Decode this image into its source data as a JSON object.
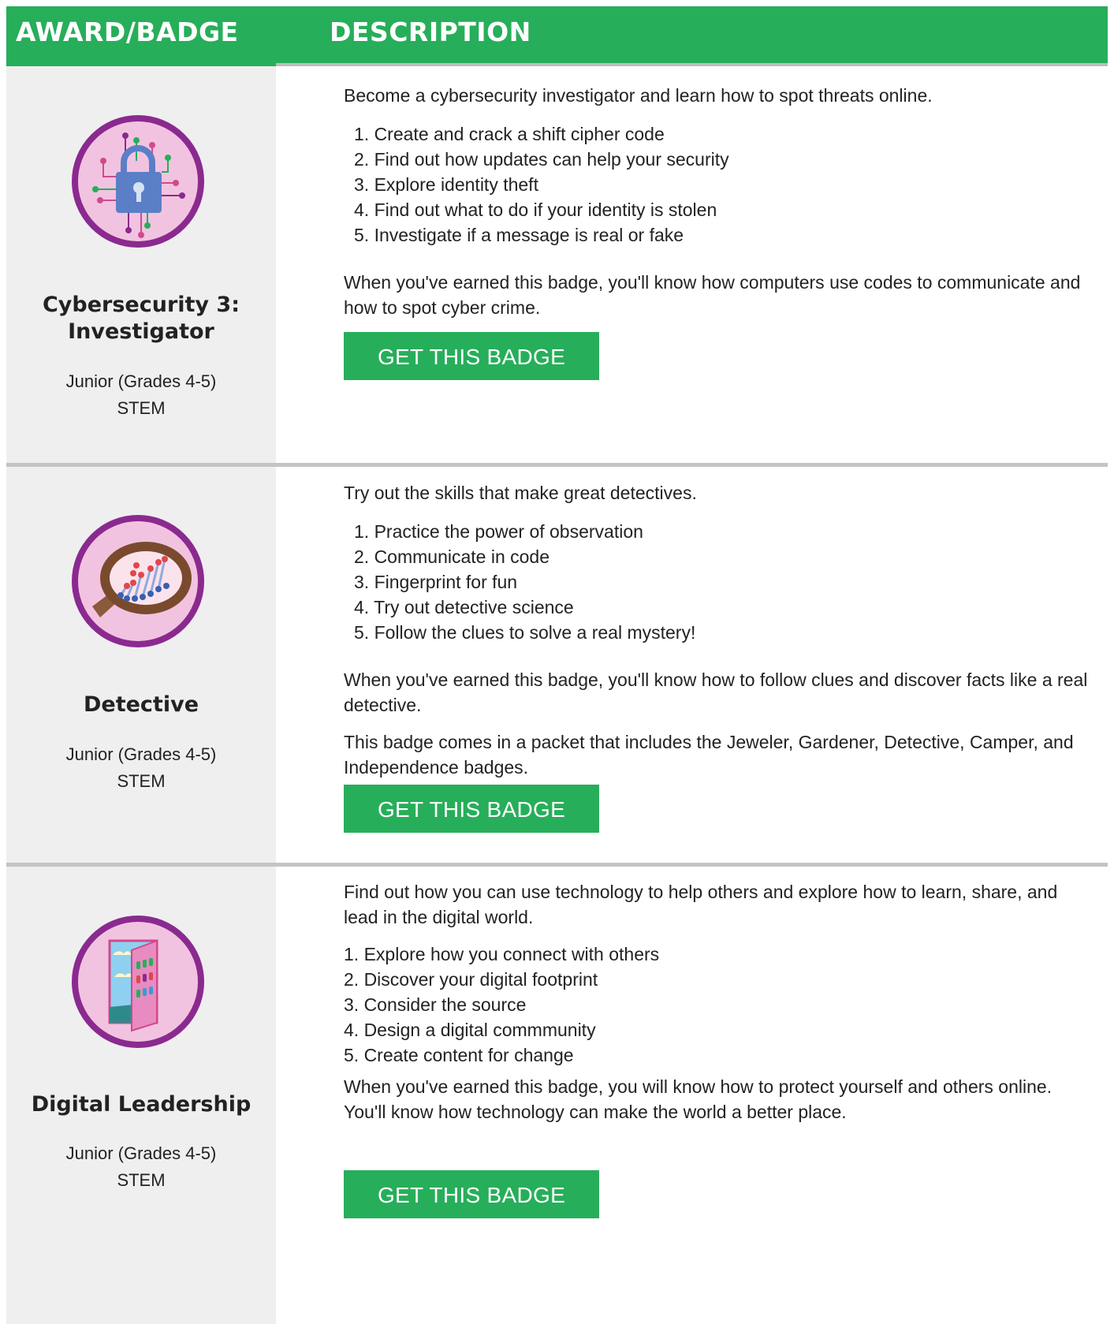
{
  "header": {
    "col_badge": "AWARD/BADGE",
    "col_description": "DESCRIPTION"
  },
  "colors": {
    "green": "#27ae5a",
    "left_column_bg": "#efefef",
    "divider": "#c4c4c4",
    "badge_ring": "#8a2a8f",
    "badge_fill": "#f2c3e0"
  },
  "badges": [
    {
      "name_line1": "Cybersecurity 3:",
      "name_line2": "Investigator",
      "level": "Junior (Grades 4-5)",
      "category": "STEM",
      "icon": "padlock-circuit-icon",
      "intro": "Become a cybersecurity investigator and learn how to spot threats online.",
      "steps": [
        "1. Create and crack a shift cipher code",
        "2. Find out how updates can help your security",
        "3. Explore identity theft",
        "4. Find out what to do if your identity is stolen",
        "5. Investigate if a message is real or fake"
      ],
      "outro": "When you've earned this badge, you'll know how computers use codes to communicate and how to spot cyber crime.",
      "button": "GET THIS BADGE"
    },
    {
      "name_line1": "Detective",
      "level": "Junior (Grades 4-5)",
      "category": "STEM",
      "icon": "magnifying-glass-dna-icon",
      "intro": "Try out the skills that make great detectives.",
      "steps": [
        "1. Practice the power of observation",
        "2. Communicate in code",
        "3. Fingerprint for fun",
        "4. Try out detective science",
        "5. Follow the clues to solve a real mystery!"
      ],
      "outro": "When you've earned this badge, you'll know how to follow clues and discover facts like a real detective.",
      "extra": "This badge comes in a packet that includes the Jeweler, Gardener, Detective, Camper, and Independence badges.",
      "button": "GET THIS BADGE"
    },
    {
      "name_line1": "Digital Leadership",
      "level": "Junior (Grades 4-5)",
      "category": "STEM",
      "icon": "digital-door-icon",
      "intro": "Find out how you can use technology to help others and explore how to learn, share, and lead in the digital world.",
      "steps": [
        "1. Explore how you connect with others",
        "2. Discover your digital footprint",
        "3. Consider the source",
        "4. Design a digital commmunity",
        "5. Create content for change"
      ],
      "outro": "When you've earned this badge, you will know how to protect yourself and others online. You'll know how technology can make the world a better place.",
      "button": "GET THIS BADGE"
    }
  ]
}
